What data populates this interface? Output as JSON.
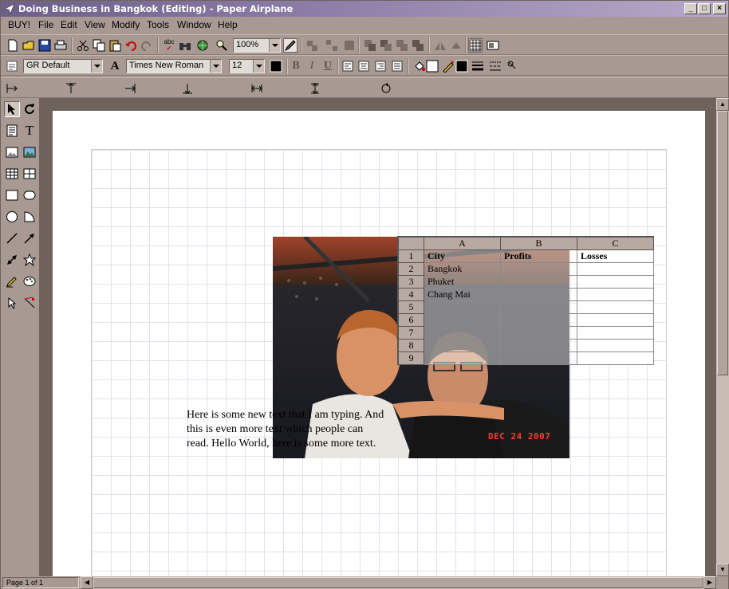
{
  "window": {
    "title": "Doing Business in Bangkok (Editing) - Paper Airplane",
    "minimize": "_",
    "maximize": "□",
    "close": "×"
  },
  "menu": {
    "items": [
      "BUY!",
      "File",
      "Edit",
      "View",
      "Modify",
      "Tools",
      "Window",
      "Help"
    ]
  },
  "toolbar": {
    "zoom_value": "100%",
    "style_value": "GR Default",
    "font_value": "Times New Roman",
    "size_value": "12",
    "bold": "B",
    "italic": "I",
    "underline": "U",
    "spell_label": "abc"
  },
  "spreadsheet": {
    "columns": [
      "A",
      "B",
      "C"
    ],
    "rows": [
      {
        "n": "1",
        "a": "City",
        "b": "Profits",
        "c": "Losses",
        "bold": true
      },
      {
        "n": "2",
        "a": "Bangkok",
        "b": "",
        "c": ""
      },
      {
        "n": "3",
        "a": "Phuket",
        "b": "",
        "c": ""
      },
      {
        "n": "4",
        "a": "Chang Mai",
        "b": "",
        "c": ""
      },
      {
        "n": "5",
        "a": "",
        "b": "",
        "c": ""
      },
      {
        "n": "6",
        "a": "",
        "b": "",
        "c": ""
      },
      {
        "n": "7",
        "a": "",
        "b": "",
        "c": ""
      },
      {
        "n": "8",
        "a": "",
        "b": "",
        "c": ""
      },
      {
        "n": "9",
        "a": "",
        "b": "",
        "c": ""
      }
    ]
  },
  "photo": {
    "date_stamp": "DEC 24 2007"
  },
  "text_block": {
    "line1": "Here is some new text that I am typing.  And",
    "line2": "this is even more text which people can",
    "line3": "read.  Hello World, here is some more text."
  },
  "status": {
    "page_indicator": "Page 1 of 1"
  },
  "colors": {
    "title_gradient_start": "#6d5f87",
    "chrome": "#a89a92",
    "desk": "#6e625c",
    "sheet_header": "#b9a9a3"
  }
}
